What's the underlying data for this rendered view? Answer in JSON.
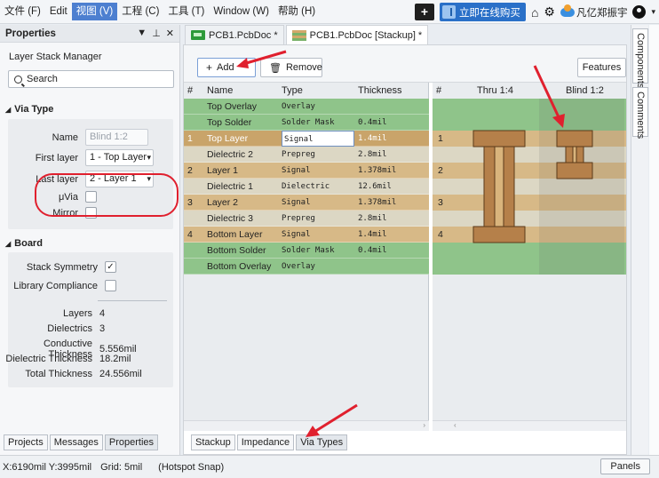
{
  "menu": {
    "items": [
      {
        "label": "文件 (F)",
        "active": false
      },
      {
        "label": "Edit",
        "active": false
      },
      {
        "label": "视图 (V)",
        "active": true
      },
      {
        "label": "工程 (C)",
        "active": false
      },
      {
        "label": "工具 (T)",
        "active": false
      },
      {
        "label": "Window (W)",
        "active": false
      },
      {
        "label": "帮助 (H)",
        "active": false
      }
    ],
    "buy_label": "立即在线购买",
    "user_name": "凡亿郑振宇"
  },
  "properties_panel": {
    "title": "Properties",
    "subtitle": "Layer Stack Manager",
    "search_placeholder": "Search",
    "via_type": {
      "section_label": "Via Type",
      "name_label": "Name",
      "name_value": "Blind 1:2",
      "first_layer_label": "First layer",
      "first_layer_value": "1 - Top Layer",
      "last_layer_label": "Last layer",
      "last_layer_value": "2 - Layer 1",
      "uvia_label": "μVia",
      "mirror_label": "Mirror"
    },
    "board": {
      "section_label": "Board",
      "stack_symmetry_label": "Stack Symmetry",
      "stack_symmetry_checked": true,
      "library_compliance_label": "Library Compliance",
      "library_compliance_checked": false,
      "layers_label": "Layers",
      "layers_value": "4",
      "dielectrics_label": "Dielectrics",
      "dielectrics_value": "3",
      "conductive_label": "Conductive Thickness",
      "conductive_value": "5.556mil",
      "dielectric_label": "Dielectric Thickness",
      "dielectric_value": "18.2mil",
      "total_label": "Total Thickness",
      "total_value": "24.556mil"
    },
    "bottom_tabs": [
      "Projects",
      "Messages",
      "Properties"
    ]
  },
  "doc_tabs": [
    {
      "label": "PCB1.PcbDoc *"
    },
    {
      "label": "PCB1.PcbDoc [Stackup] *"
    }
  ],
  "toolbar": {
    "add_label": "Add",
    "remove_label": "Remove",
    "features_label": "Features"
  },
  "stack_table": {
    "headers": [
      "#",
      "Name",
      "Type",
      "Thickness"
    ],
    "rows": [
      {
        "num": "",
        "name": "Top Overlay",
        "type": "Overlay",
        "thickness": "",
        "kind": "green"
      },
      {
        "num": "",
        "name": "Top Solder",
        "type": "Solder Mask",
        "thickness": "0.4mil",
        "kind": "green"
      },
      {
        "num": "1",
        "name": "Top Layer",
        "type": "Signal",
        "thickness": "1.4mil",
        "kind": "selected"
      },
      {
        "num": "",
        "name": "Dielectric 2",
        "type": "Prepreg",
        "thickness": "2.8mil",
        "kind": "diel"
      },
      {
        "num": "2",
        "name": "Layer 1",
        "type": "Signal",
        "thickness": "1.378mil",
        "kind": "signal"
      },
      {
        "num": "",
        "name": "Dielectric 1",
        "type": "Dielectric",
        "thickness": "12.6mil",
        "kind": "diel"
      },
      {
        "num": "3",
        "name": "Layer 2",
        "type": "Signal",
        "thickness": "1.378mil",
        "kind": "signal"
      },
      {
        "num": "",
        "name": "Dielectric 3",
        "type": "Prepreg",
        "thickness": "2.8mil",
        "kind": "diel"
      },
      {
        "num": "4",
        "name": "Bottom Layer",
        "type": "Signal",
        "thickness": "1.4mil",
        "kind": "signal"
      },
      {
        "num": "",
        "name": "Bottom Solder",
        "type": "Solder Mask",
        "thickness": "0.4mil",
        "kind": "green"
      },
      {
        "num": "",
        "name": "Bottom Overlay",
        "type": "Overlay",
        "thickness": "",
        "kind": "green"
      }
    ]
  },
  "via_table": {
    "headers": [
      "#",
      "Thru 1:4",
      "Blind 1:2"
    ]
  },
  "doc_bottom_tabs": [
    "Stackup",
    "Impedance",
    "Via Types"
  ],
  "side_tabs": [
    "Components",
    "Comments"
  ],
  "status": {
    "coords": "X:6190mil Y:3995mil",
    "grid": "Grid: 5mil",
    "snap": "(Hotspot Snap)",
    "panels_label": "Panels"
  },
  "colors": {
    "green_row": "#8fc48a",
    "signal_row": "#d7b987",
    "dielectric_row": "#dcd7c4",
    "selected_row": "#c9a46a",
    "accent": "#4d7fd0",
    "annotation_red": "#e0202e"
  }
}
